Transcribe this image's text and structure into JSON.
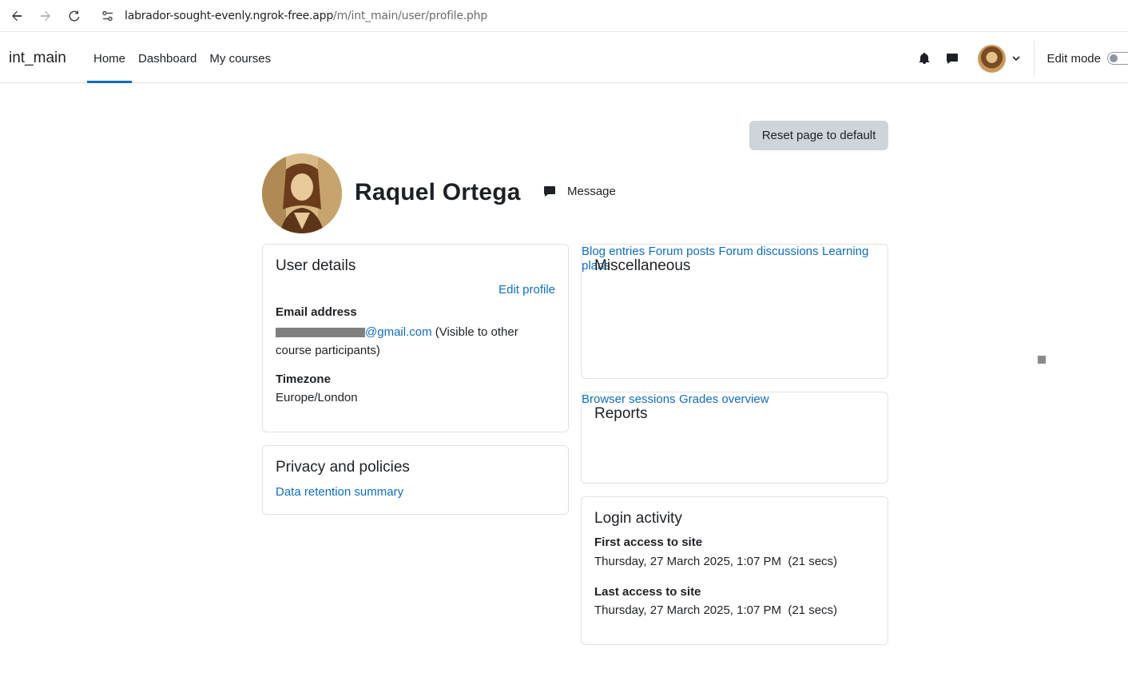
{
  "browser": {
    "url_host": "labrador-sought-evenly.ngrok-free.app",
    "url_path": "/m/int_main/user/profile.php"
  },
  "navbar": {
    "brand": "int_main",
    "items": [
      {
        "label": "Home",
        "active": true
      },
      {
        "label": "Dashboard",
        "active": false
      },
      {
        "label": "My courses",
        "active": false
      }
    ],
    "edit_mode_label": "Edit mode"
  },
  "page": {
    "reset_label": "Reset page to default",
    "fullname": "Raquel Ortega",
    "message_label": "Message"
  },
  "user_details": {
    "title": "User details",
    "edit_profile": "Edit profile",
    "email_label": "Email address",
    "email_visible": "@gmail.com",
    "email_note": "(Visible to other course participants)",
    "timezone_label": "Timezone",
    "timezone_value": "Europe/London"
  },
  "privacy": {
    "title": "Privacy and policies",
    "link": "Data retention summary"
  },
  "misc": {
    "title": "Miscellaneous",
    "links": [
      "Blog entries",
      "Forum posts",
      "Forum discussions",
      "Learning plans"
    ]
  },
  "reports": {
    "title": "Reports",
    "links": [
      "Browser sessions",
      "Grades overview"
    ]
  },
  "login": {
    "title": "Login activity",
    "first_label": "First access to site",
    "first_value": "Thursday, 27 March 2025, 1:07 PM  (21 secs)",
    "last_label": "Last access to site",
    "last_value": "Thursday, 27 March 2025, 1:07 PM  (21 secs)"
  },
  "colors": {
    "link": "#0f6cbf",
    "text": "#1d2125",
    "button_bg": "#ced4da",
    "border": "#dee2e6"
  }
}
